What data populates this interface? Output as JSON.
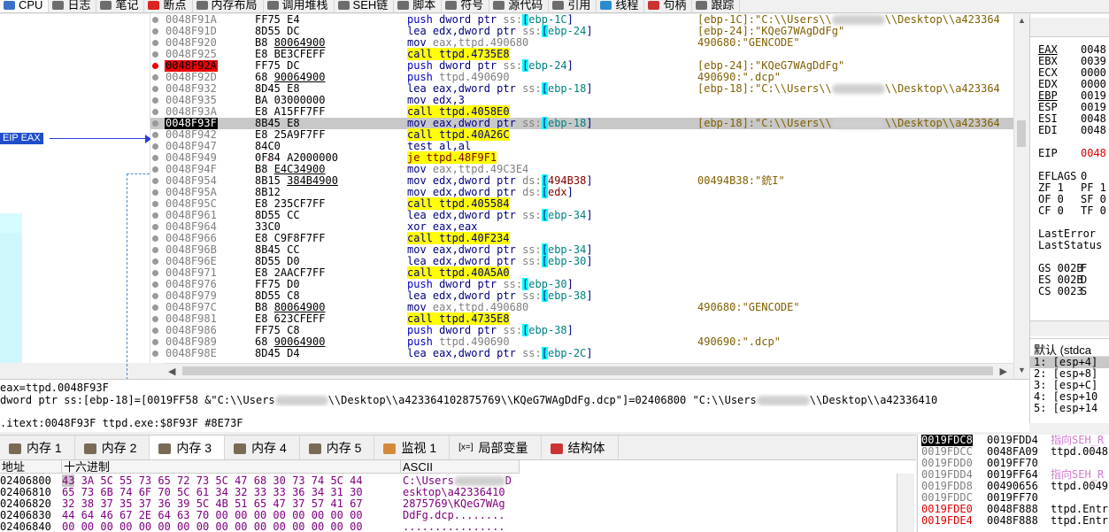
{
  "tabs": [
    {
      "label": "CPU",
      "icon": "cpu-icon",
      "color": "#3b73c9",
      "active": true
    },
    {
      "label": "日志",
      "icon": "log-icon",
      "color": "#6d6d6d"
    },
    {
      "label": "笔记",
      "icon": "notes-icon",
      "color": "#6d6d6d"
    },
    {
      "label": "断点",
      "icon": "breakpoint-icon",
      "color": "#d22"
    },
    {
      "label": "内存布局",
      "icon": "memory-map-icon",
      "color": "#6d6d6d"
    },
    {
      "label": "调用堆栈",
      "icon": "call-stack-icon",
      "color": "#6d6d6d"
    },
    {
      "label": "SEH链",
      "icon": "seh-icon",
      "color": "#6d6d6d"
    },
    {
      "label": "脚本",
      "icon": "script-icon",
      "color": "#6d6d6d"
    },
    {
      "label": "符号",
      "icon": "symbols-icon",
      "color": "#6d6d6d"
    },
    {
      "label": "源代码",
      "icon": "source-icon",
      "color": "#6d6d6d"
    },
    {
      "label": "引用",
      "icon": "references-icon",
      "color": "#6d6d6d"
    },
    {
      "label": "线程",
      "icon": "threads-icon",
      "color": "#2a8cd0"
    },
    {
      "label": "句柄",
      "icon": "handles-icon",
      "color": "#c33"
    },
    {
      "label": "跟踪",
      "icon": "trace-icon",
      "color": "#6d6d6d"
    }
  ],
  "gutter": {
    "eip_label": "EIP EAX"
  },
  "disasm": [
    {
      "addr": "0048F91A",
      "hex": "FF75 E4",
      "ins": "push dword ptr ss:[ebp-1C]",
      "type": "push",
      "cmt": "[ebp-1C]:\"C:\\\\Users\\\\",
      "cmt2": "\\\\Desktop\\\\a423364"
    },
    {
      "addr": "0048F91D",
      "hex": "8D55 DC",
      "ins": "lea edx,dword ptr ss:[ebp-24]",
      "type": "lea",
      "cmt": "[ebp-24]:\"KQeG7WAgDdFg\""
    },
    {
      "addr": "0048F920",
      "hex": "B8 80064900",
      "ins": "mov eax,ttpd.490680",
      "type": "mov",
      "cmt": "490680:\"GENCODE\"",
      "hexu": true
    },
    {
      "addr": "0048F925",
      "hex": "E8 BE3CFEFF",
      "ins": "call ttpd.4735E8",
      "type": "call"
    },
    {
      "addr": "0048F92A",
      "hex": "FF75 DC",
      "ins": "push dword ptr ss:[ebp-24]",
      "type": "push",
      "cmt": "[ebp-24]:\"KQeG7WAgDdFg\"",
      "bp": "red"
    },
    {
      "addr": "0048F92D",
      "hex": "68 90064900",
      "ins": "push ttpd.490690",
      "type": "push",
      "cmt": "490690:\".dcp\"",
      "hexu": true
    },
    {
      "addr": "0048F932",
      "hex": "8D45 E8",
      "ins": "lea eax,dword ptr ss:[ebp-18]",
      "type": "lea",
      "cmt": "[ebp-18]:\"C:\\\\Users\\\\",
      "cmt2": "\\\\Desktop\\\\a423364"
    },
    {
      "addr": "0048F935",
      "hex": "BA 03000000",
      "ins": "mov edx,3",
      "type": "mov"
    },
    {
      "addr": "0048F93A",
      "hex": "E8 A15FF7FF",
      "ins": "call ttpd.4058E0",
      "type": "call"
    },
    {
      "addr": "0048F93F",
      "hex": "8B45 E8",
      "ins": "mov eax,dword ptr ss:[ebp-18]",
      "type": "mov",
      "cmt": "[ebp-18]:\"C:\\\\Users\\\\",
      "cmt2": "\\\\Desktop\\\\a423364",
      "cur": true
    },
    {
      "addr": "0048F942",
      "hex": "E8 25A9F7FF",
      "ins": "call ttpd.40A26C",
      "type": "call"
    },
    {
      "addr": "0048F947",
      "hex": "84C0",
      "ins": "test al,al",
      "type": "test"
    },
    {
      "addr": "0048F949",
      "hex": "0F84 A2000000",
      "ins": "je ttpd.48F9F1",
      "type": "je",
      "jm": true
    },
    {
      "addr": "0048F94F",
      "hex": "B8 E4C34900",
      "ins": "mov eax,ttpd.49C3E4",
      "type": "mov",
      "hexu": true
    },
    {
      "addr": "0048F954",
      "hex": "8B15 384B4900",
      "ins": "mov edx,dword ptr ds:[494B38]",
      "type": "movds",
      "cmt": "00494B38:\"銃I\"",
      "hexu": true
    },
    {
      "addr": "0048F95A",
      "hex": "8B12",
      "ins": "mov edx,dword ptr ds:[edx]",
      "type": "movds"
    },
    {
      "addr": "0048F95C",
      "hex": "E8 235CF7FF",
      "ins": "call ttpd.405584",
      "type": "call"
    },
    {
      "addr": "0048F961",
      "hex": "8D55 CC",
      "ins": "lea edx,dword ptr ss:[ebp-34]",
      "type": "lea"
    },
    {
      "addr": "0048F964",
      "hex": "33C0",
      "ins": "xor eax,eax",
      "type": "xor"
    },
    {
      "addr": "0048F966",
      "hex": "E8 C9F8F7FF",
      "ins": "call ttpd.40F234",
      "type": "call"
    },
    {
      "addr": "0048F96B",
      "hex": "8B45 CC",
      "ins": "mov eax,dword ptr ss:[ebp-34]",
      "type": "mov"
    },
    {
      "addr": "0048F96E",
      "hex": "8D55 D0",
      "ins": "lea edx,dword ptr ss:[ebp-30]",
      "type": "lea"
    },
    {
      "addr": "0048F971",
      "hex": "E8 2AACF7FF",
      "ins": "call ttpd.40A5A0",
      "type": "call"
    },
    {
      "addr": "0048F976",
      "hex": "FF75 D0",
      "ins": "push dword ptr ss:[ebp-30]",
      "type": "push"
    },
    {
      "addr": "0048F979",
      "hex": "8D55 C8",
      "ins": "lea edx,dword ptr ss:[ebp-38]",
      "type": "lea"
    },
    {
      "addr": "0048F97C",
      "hex": "B8 80064900",
      "ins": "mov eax,ttpd.490680",
      "type": "mov",
      "cmt": "490680:\"GENCODE\"",
      "hexu": true
    },
    {
      "addr": "0048F981",
      "hex": "E8 623CFEFF",
      "ins": "call ttpd.4735E8",
      "type": "call"
    },
    {
      "addr": "0048F986",
      "hex": "FF75 C8",
      "ins": "push dword ptr ss:[ebp-38]",
      "type": "push"
    },
    {
      "addr": "0048F989",
      "hex": "68 90064900",
      "ins": "push ttpd.490690",
      "type": "push",
      "cmt": "490690:\".dcp\"",
      "hexu": true
    },
    {
      "addr": "0048F98E",
      "hex": "8D45 D4",
      "ins": "lea eax,dword ptr ss:[ebp-2C]",
      "type": "lea"
    }
  ],
  "registers": [
    {
      "name": "EAX",
      "value": "0048",
      "underline": true
    },
    {
      "name": "EBX",
      "value": "0039"
    },
    {
      "name": "ECX",
      "value": "0000"
    },
    {
      "name": "EDX",
      "value": "0000"
    },
    {
      "name": "EBP",
      "value": "0019",
      "underline": true
    },
    {
      "name": "ESP",
      "value": "0019"
    },
    {
      "name": "ESI",
      "value": "0048"
    },
    {
      "name": "EDI",
      "value": "0048"
    },
    {
      "name": "",
      "value": ""
    },
    {
      "name": "EIP",
      "value": "0048",
      "red": true
    },
    {
      "name": "",
      "value": ""
    },
    {
      "name": "EFLAGS",
      "value": "0"
    },
    {
      "name": "ZF 1",
      "value": "PF 1"
    },
    {
      "name": "OF 0",
      "value": "SF 0"
    },
    {
      "name": "CF 0",
      "value": "TF 0"
    },
    {
      "name": "",
      "value": ""
    },
    {
      "name": "LastError",
      "value": ""
    },
    {
      "name": "LastStatus",
      "value": ""
    },
    {
      "name": "",
      "value": ""
    },
    {
      "name": "GS 002B",
      "value": "F"
    },
    {
      "name": "ES 002B",
      "value": "D"
    },
    {
      "name": "CS 0023",
      "value": "S"
    }
  ],
  "callstack": {
    "header": "默认 (stdca",
    "items": [
      "1: [esp+4]",
      "2: [esp+8]",
      "3: [esp+C]",
      "4: [esp+10",
      "5: [esp+14"
    ]
  },
  "info": {
    "line1": "eax=ttpd.0048F93F",
    "line2a": "dword ptr ss:[ebp-18]=[0019FF58 &\"C:\\\\Users",
    "line2b": "\\\\Desktop\\\\a423364102875769\\\\KQeG7WAgDdFg.dcp\"]=02406800 \"C:\\\\Users",
    "line2c": "\\\\Desktop\\\\a42336410",
    "line3": ".itext:0048F93F ttpd.exe:$8F93F #8E73F"
  },
  "dump_tabs": [
    {
      "label": "内存 1",
      "icon": "memory-icon"
    },
    {
      "label": "内存 2",
      "icon": "memory-icon"
    },
    {
      "label": "内存 3",
      "icon": "memory-icon",
      "active": true
    },
    {
      "label": "内存 4",
      "icon": "memory-icon"
    },
    {
      "label": "内存 5",
      "icon": "memory-icon"
    },
    {
      "label": "监视 1",
      "icon": "watch-icon"
    },
    {
      "label": "局部变量",
      "icon": "locals-icon",
      "prefix": "[x=]"
    },
    {
      "label": "结构体",
      "icon": "struct-icon"
    }
  ],
  "dump": {
    "headers": {
      "addr": "地址",
      "hex": "十六进制",
      "ascii": "ASCII"
    },
    "rows": [
      {
        "addr": "02406800",
        "hex": "43 3A 5C 55 73 65 72 73 5C 47 68 30 73 74 5C 44",
        "ascii": "C:\\Users",
        "ascii2": "D"
      },
      {
        "addr": "02406810",
        "hex": "65 73 6B 74 6F 70 5C 61 34 32 33 33 36 34 31 30",
        "ascii": "esktop\\a42336410"
      },
      {
        "addr": "02406820",
        "hex": "32 38 37 35 37 36 39 5C 4B 51 65 47 37 57 41 67",
        "ascii": "2875769\\KQeG7WAg"
      },
      {
        "addr": "02406830",
        "hex": "44 64 46 67 2E 64 63 70 00 00 00 00 00 00 00 00",
        "ascii": "DdFg.dcp........"
      },
      {
        "addr": "02406840",
        "hex": "00 00 00 00 00 00 00 00 00 00 00 00 00 00 00 00",
        "ascii": "................"
      }
    ]
  },
  "stack": [
    {
      "addr": "0019FDC8",
      "val": "0019FDD4",
      "cmt": "指向SEH_R",
      "sel": true,
      "pink": true
    },
    {
      "addr": "0019FDCC",
      "val": "0048FA09",
      "cmt": "ttpd.0048"
    },
    {
      "addr": "0019FDD0",
      "val": "0019FF70",
      "cmt": ""
    },
    {
      "addr": "0019FDD4",
      "val": "0019FF64",
      "cmt": "指向SEH_R",
      "pink": true
    },
    {
      "addr": "0019FDD8",
      "val": "00490656",
      "cmt": "ttpd.0049"
    },
    {
      "addr": "0019FDDC",
      "val": "0019FF70",
      "cmt": ""
    },
    {
      "addr": "0019FDE0",
      "val": "0048F888",
      "cmt": "ttpd.Entr",
      "red": true
    },
    {
      "addr": "0019FDE4",
      "val": "0048F888",
      "cmt": "ttpd.Entr",
      "red": true
    }
  ]
}
